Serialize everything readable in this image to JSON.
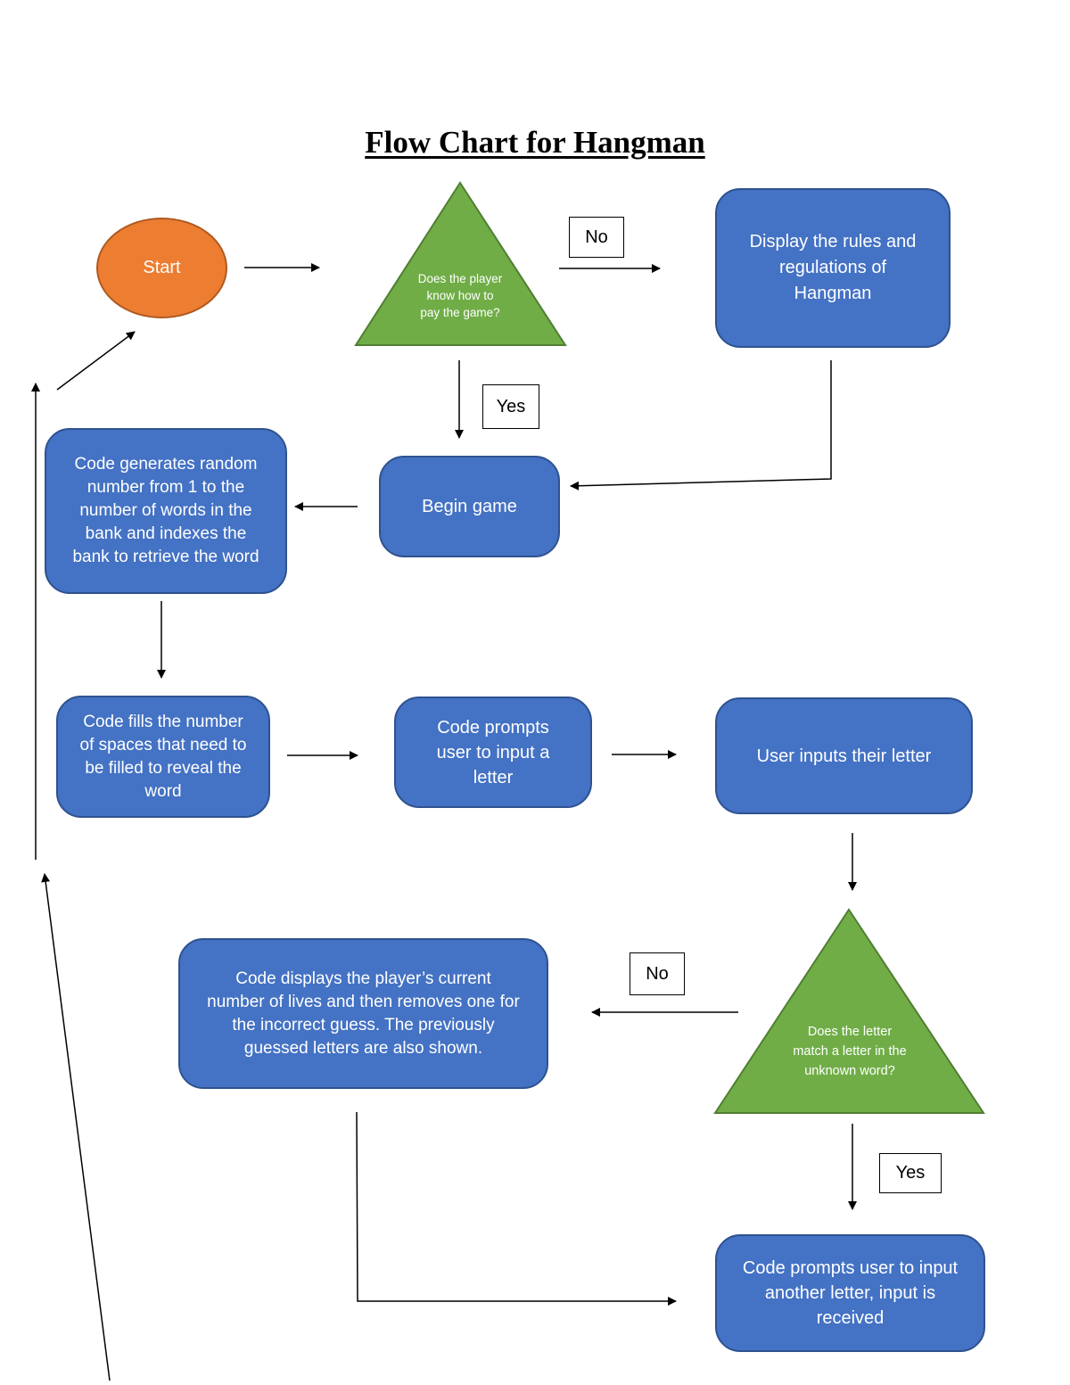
{
  "title": "Flow Chart for Hangman",
  "nodes": {
    "start": "Start",
    "decision_knows_game": "Does the player know how to pay the game?",
    "display_rules": "Display the rules and regulations of Hangman",
    "begin_game": "Begin game",
    "generate_random": "Code generates random number from 1 to the number of words in the bank and indexes the bank to retrieve the word",
    "fill_spaces": "Code fills the number of spaces that need to be filled to reveal the word",
    "prompt_letter": "Code prompts user to input a letter",
    "user_inputs": "User inputs their letter",
    "decision_letter_match": "Does the letter match a letter in the unknown word?",
    "wrong_guess": "Code displays the player’s current number of lives and then removes one for the incorrect guess. The previously guessed letters are also shown.",
    "prompt_another": "Code prompts user to input another letter, input is received"
  },
  "labels": {
    "no_top": "No",
    "yes_top": "Yes",
    "no_bottom": "No",
    "yes_bottom": "Yes"
  },
  "colors": {
    "process_fill": "#4472C4",
    "decision_fill": "#70AD47",
    "start_fill": "#ED7D31"
  }
}
